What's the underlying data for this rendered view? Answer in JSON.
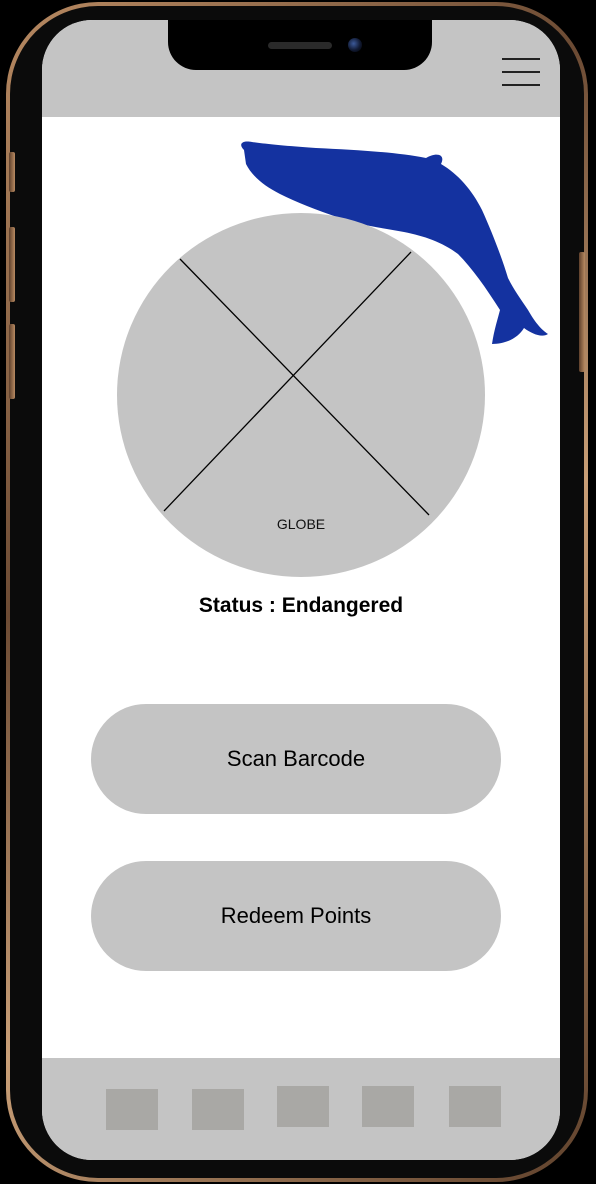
{
  "header": {
    "menu_icon": "hamburger-menu-icon"
  },
  "globe": {
    "label": "GLOBE",
    "illustration": "whale-silhouette",
    "whale_color": "#1432a0",
    "fill_color": "#c4c4c4"
  },
  "status": {
    "text": "Status : Endangered"
  },
  "actions": {
    "scan_label": "Scan Barcode",
    "redeem_label": "Redeem Points"
  },
  "bottom_nav": {
    "item_count": 5
  },
  "colors": {
    "bar_gray": "#c4c4c4",
    "tab_placeholder": "#a9a8a5",
    "frame_gold": "#b88a62"
  }
}
